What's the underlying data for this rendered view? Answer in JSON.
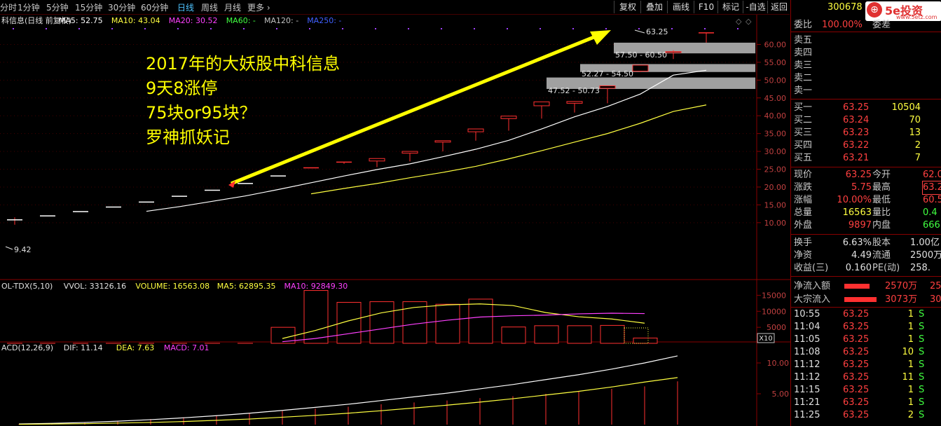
{
  "toolbar": {
    "tabs": [
      "分时",
      "1分钟",
      "5分钟",
      "15分钟",
      "30分钟",
      "60分钟",
      "日线",
      "周线",
      "月线",
      "更多 ›"
    ],
    "buttons": [
      "复权",
      "叠加",
      "画线",
      "F10",
      "标记",
      "-自选",
      "返回"
    ]
  },
  "stock": {
    "code": "300678",
    "logo_text": "5e投资",
    "logo_sub": "www.5etz.com"
  },
  "main_legend": [
    {
      "text": "科信息(日线 前复权)",
      "color": "#e0e0e0"
    },
    {
      "text": "MA5: 52.75",
      "color": "#ffffff"
    },
    {
      "text": "MA10: 43.04",
      "color": "#ffff40"
    },
    {
      "text": "MA20: 30.52",
      "color": "#ff40ff"
    },
    {
      "text": "MA60: -",
      "color": "#40ff40"
    },
    {
      "text": "MA120: -",
      "color": "#c0c0c0"
    },
    {
      "text": "MA250: -",
      "color": "#4060ff"
    }
  ],
  "vol_legend": [
    {
      "text": "OL-TDX(5,10)",
      "color": "#e0e0e0"
    },
    {
      "text": "VVOL: 33126.16",
      "color": "#e0e0e0"
    },
    {
      "text": "VOLUME: 16563.08",
      "color": "#ffff40"
    },
    {
      "text": "MA5: 62895.35",
      "color": "#ffff40"
    },
    {
      "text": "MA10: 92849.30",
      "color": "#ff40ff"
    }
  ],
  "macd_legend": [
    {
      "text": "ACD(12,26,9)",
      "color": "#e0e0e0"
    },
    {
      "text": "DIF: 11.14",
      "color": "#e0e0e0"
    },
    {
      "text": "DEA: 7.63",
      "color": "#ffff40"
    },
    {
      "text": "MACD: 7.01",
      "color": "#ff40ff"
    }
  ],
  "annotation": {
    "lines": [
      "2017年的大妖股中科信息",
      "9天8涨停",
      "75块or95块？",
      "罗神抓妖记"
    ],
    "color": "#ffff00"
  },
  "gap_labels": [
    "57.50 - 60.50",
    "52.27 - 54.50",
    "47.52 - 50.73"
  ],
  "price_labels": {
    "high": "63.25",
    "low": "9.42"
  },
  "vol_scale_label": "X10",
  "chart_data": [
    {
      "type": "candlestick",
      "name": "price",
      "open": [
        10.8,
        11.9,
        13.1,
        14.4,
        15.8,
        17.4,
        19.1,
        21.0,
        23.1,
        25.4,
        27.0,
        28.0,
        29.5,
        32.6,
        35.5,
        39.2,
        42.8,
        44.0,
        48.4,
        54.2,
        58.0,
        63.2
      ],
      "close": [
        10.8,
        11.9,
        13.1,
        14.4,
        15.8,
        17.4,
        19.1,
        21.0,
        23.1,
        25.4,
        26.8,
        27.3,
        30.0,
        33.0,
        36.3,
        39.9,
        43.9,
        43.5,
        47.7,
        52.5,
        57.7,
        63.25
      ],
      "high": [
        11.5,
        11.9,
        13.1,
        14.4,
        15.8,
        17.4,
        19.1,
        21.0,
        23.1,
        25.4,
        27.0,
        28.0,
        30.0,
        33.0,
        36.3,
        39.9,
        43.9,
        44.1,
        48.4,
        54.2,
        58.4,
        63.25
      ],
      "low": [
        9.42,
        11.9,
        13.1,
        14.4,
        15.8,
        17.4,
        19.1,
        21.0,
        23.1,
        25.4,
        26.5,
        25.6,
        27.2,
        30.0,
        33.0,
        35.8,
        39.2,
        40.9,
        43.5,
        52.3,
        55.9,
        60.5
      ],
      "ma5": [
        null,
        null,
        null,
        null,
        13.2,
        14.5,
        16.0,
        17.5,
        19.3,
        21.2,
        23.1,
        24.9,
        26.5,
        28.5,
        30.6,
        33.1,
        36.3,
        39.7,
        42.6,
        46.1,
        51.4,
        52.75
      ],
      "ma10": [
        null,
        null,
        null,
        null,
        null,
        null,
        null,
        null,
        null,
        18.1,
        19.6,
        21.0,
        22.6,
        24.1,
        25.8,
        27.9,
        30.2,
        32.6,
        35.0,
        37.9,
        41.2,
        43.04
      ],
      "ma20": [],
      "ylim": [
        8,
        65
      ],
      "yticks": [
        10.0,
        15.0,
        20.0,
        25.0,
        30.0,
        35.0,
        40.0,
        45.0,
        50.0,
        55.0,
        60.0
      ]
    },
    {
      "type": "bar",
      "name": "volume",
      "values": [
        0,
        50,
        60,
        70,
        80,
        90,
        100,
        150,
        200,
        250,
        300,
        400,
        450,
        500,
        550,
        650,
        800,
        700,
        750,
        900,
        1656,
        0
      ],
      "vbars": [
        null,
        null,
        null,
        null,
        null,
        null,
        null,
        null,
        5000,
        16500,
        12800,
        13000,
        13000,
        12200,
        13800,
        5100,
        5500,
        5500,
        5600,
        1656
      ],
      "ma5_line": [
        null,
        null,
        null,
        null,
        null,
        null,
        null,
        null,
        1500,
        4000,
        7000,
        9500,
        11200,
        12000,
        12300,
        11800,
        9600,
        8300,
        7600,
        6290
      ],
      "ma10_line": [
        null,
        null,
        null,
        null,
        null,
        null,
        null,
        null,
        500,
        1500,
        3000,
        4500,
        6000,
        7200,
        8200,
        8600,
        8800,
        9200,
        9400,
        9285
      ],
      "ylim": [
        0,
        17500
      ],
      "yticks": [
        5000,
        10000,
        15000
      ]
    },
    {
      "type": "line",
      "name": "macd",
      "dif": [
        0.1,
        0.2,
        0.35,
        0.55,
        0.8,
        1.1,
        1.45,
        1.85,
        2.3,
        2.8,
        3.3,
        3.9,
        4.5,
        5.1,
        5.8,
        6.5,
        7.3,
        8.1,
        9.0,
        10.0,
        11.14
      ],
      "dea": [
        0.05,
        0.1,
        0.15,
        0.25,
        0.35,
        0.5,
        0.7,
        0.9,
        1.2,
        1.5,
        1.85,
        2.25,
        2.7,
        3.15,
        3.65,
        4.2,
        4.8,
        5.4,
        6.1,
        6.9,
        7.63
      ],
      "ylim": [
        0,
        12.5
      ],
      "yticks": [
        5.0,
        10.0
      ]
    }
  ],
  "quote": {
    "weibi": {
      "label": "委比",
      "value": "100.00%",
      "extra": "委差"
    },
    "asks": [
      {
        "label": "卖五"
      },
      {
        "label": "卖四"
      },
      {
        "label": "卖三"
      },
      {
        "label": "卖二"
      },
      {
        "label": "卖一"
      }
    ],
    "bids": [
      {
        "label": "买一",
        "price": "63.25",
        "vol": "10504"
      },
      {
        "label": "买二",
        "price": "63.24",
        "vol": "70"
      },
      {
        "label": "买三",
        "price": "63.23",
        "vol": "13"
      },
      {
        "label": "买四",
        "price": "63.22",
        "vol": "2"
      },
      {
        "label": "买五",
        "price": "63.21",
        "vol": "7"
      }
    ],
    "stats": [
      {
        "l1": "现价",
        "v1": "63.25",
        "c1": "red",
        "l2": "今开",
        "v2": "62.0",
        "c2": "red"
      },
      {
        "l1": "涨跌",
        "v1": "5.75",
        "c1": "red",
        "l2": "最高",
        "v2": "63.2",
        "c2": "red"
      },
      {
        "l1": "涨幅",
        "v1": "10.00%",
        "c1": "red",
        "l2": "最低",
        "v2": "60.5",
        "c2": "red"
      },
      {
        "l1": "总量",
        "v1": "16563",
        "c1": "yel",
        "l2": "量比",
        "v2": "0.4",
        "c2": "grn"
      },
      {
        "l1": "外盘",
        "v1": "9897",
        "c1": "red",
        "l2": "内盘",
        "v2": "666",
        "c2": "grn"
      }
    ],
    "stats2": [
      {
        "l1": "换手",
        "v1": "6.63%",
        "l2": "股本",
        "v2": "1.00亿"
      },
      {
        "l1": "净资",
        "v1": "4.49",
        "l2": "流通",
        "v2": "2500万"
      },
      {
        "l1": "收益(三)",
        "v1": "0.160",
        "l2": "PE(动)",
        "v2": "258."
      }
    ],
    "flows": [
      {
        "label": "净流入额",
        "value": "2570万",
        "extra": "25"
      },
      {
        "label": "大宗流入",
        "value": "3073万",
        "extra": "30"
      }
    ],
    "ticks": [
      {
        "time": "10:55",
        "price": "63.25",
        "vol": "1",
        "side": "S"
      },
      {
        "time": "11:04",
        "price": "63.25",
        "vol": "1",
        "side": "S"
      },
      {
        "time": "11:05",
        "price": "63.25",
        "vol": "1",
        "side": "S"
      },
      {
        "time": "11:08",
        "price": "63.25",
        "vol": "10",
        "side": "S"
      },
      {
        "time": "11:12",
        "price": "63.25",
        "vol": "1",
        "side": "S"
      },
      {
        "time": "11:12",
        "price": "63.25",
        "vol": "11",
        "side": "S"
      },
      {
        "time": "11:15",
        "price": "63.25",
        "vol": "1",
        "side": "S"
      },
      {
        "time": "11:21",
        "price": "63.25",
        "vol": "1",
        "side": "S"
      },
      {
        "time": "11:25",
        "price": "63.25",
        "vol": "2",
        "side": "S"
      }
    ]
  }
}
